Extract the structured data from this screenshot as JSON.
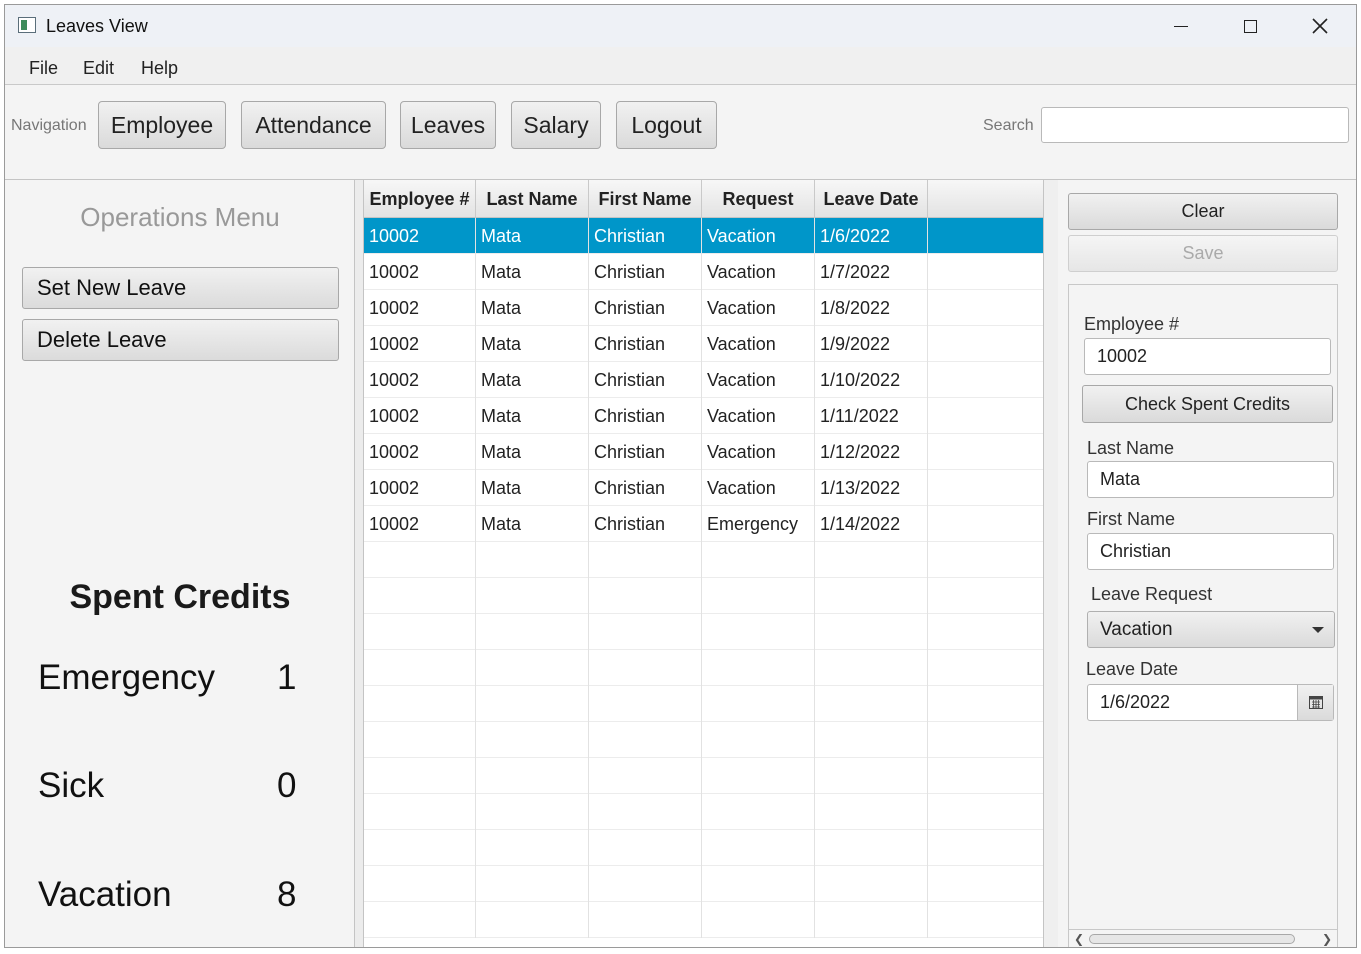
{
  "window": {
    "title": "Leaves View"
  },
  "menubar": {
    "items": [
      "File",
      "Edit",
      "Help"
    ]
  },
  "toolbar": {
    "nav_label": "Navigation",
    "buttons": [
      "Employee",
      "Attendance",
      "Leaves",
      "Salary",
      "Logout"
    ],
    "search_label": "Search",
    "search_value": ""
  },
  "operations": {
    "title": "Operations Menu",
    "set_new_leave": "Set New Leave",
    "delete_leave": "Delete Leave"
  },
  "credits": {
    "title": "Spent Credits",
    "items": [
      {
        "label": "Emergency",
        "value": "1"
      },
      {
        "label": "Sick",
        "value": "0"
      },
      {
        "label": "Vacation",
        "value": "8"
      }
    ]
  },
  "table": {
    "columns": [
      "Employee #",
      "Last Name",
      "First Name",
      "Request",
      "Leave Date"
    ],
    "selected_index": 0,
    "rows": [
      [
        "10002",
        "Mata",
        "Christian",
        "Vacation",
        "1/6/2022"
      ],
      [
        "10002",
        "Mata",
        "Christian",
        "Vacation",
        "1/7/2022"
      ],
      [
        "10002",
        "Mata",
        "Christian",
        "Vacation",
        "1/8/2022"
      ],
      [
        "10002",
        "Mata",
        "Christian",
        "Vacation",
        "1/9/2022"
      ],
      [
        "10002",
        "Mata",
        "Christian",
        "Vacation",
        "1/10/2022"
      ],
      [
        "10002",
        "Mata",
        "Christian",
        "Vacation",
        "1/11/2022"
      ],
      [
        "10002",
        "Mata",
        "Christian",
        "Vacation",
        "1/12/2022"
      ],
      [
        "10002",
        "Mata",
        "Christian",
        "Vacation",
        "1/13/2022"
      ],
      [
        "10002",
        "Mata",
        "Christian",
        "Emergency",
        "1/14/2022"
      ]
    ]
  },
  "form": {
    "clear_label": "Clear",
    "save_label": "Save",
    "employee_label": "Employee #",
    "employee_value": "10002",
    "check_credits_label": "Check Spent Credits",
    "last_name_label": "Last Name",
    "last_name_value": "Mata",
    "first_name_label": "First Name",
    "first_name_value": "Christian",
    "leave_request_label": "Leave Request",
    "leave_request_value": "Vacation",
    "leave_date_label": "Leave Date",
    "leave_date_value": "1/6/2022"
  },
  "colors": {
    "selection": "#0096c9"
  }
}
